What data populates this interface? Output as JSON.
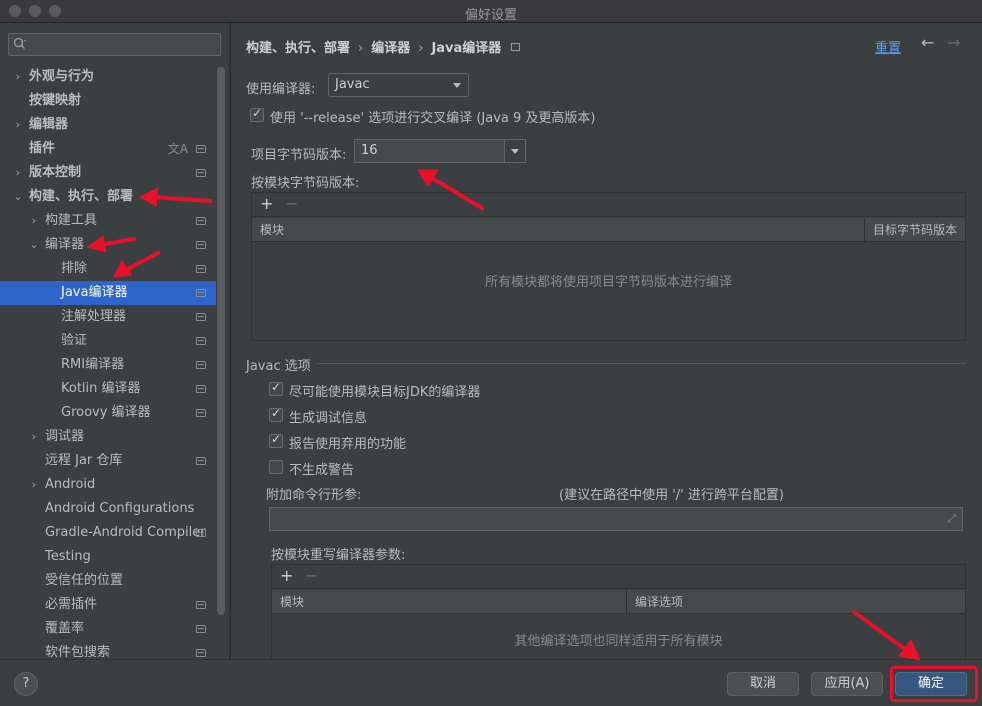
{
  "window": {
    "title": "偏好设置"
  },
  "sidebar": {
    "search_placeholder": "",
    "items": [
      {
        "label": "外观与行为",
        "level": 0,
        "arrow": "›",
        "bold": true
      },
      {
        "label": "按键映射",
        "level": 0,
        "arrow": "",
        "bold": true
      },
      {
        "label": "编辑器",
        "level": 0,
        "arrow": "›",
        "bold": true
      },
      {
        "label": "插件",
        "level": 0,
        "arrow": "",
        "bold": true,
        "lang_icon": "文A",
        "module_icon": true
      },
      {
        "label": "版本控制",
        "level": 0,
        "arrow": "›",
        "bold": true,
        "module_icon": true
      },
      {
        "label": "构建、执行、部署",
        "level": 0,
        "arrow": "⌄",
        "bold": true
      },
      {
        "label": "构建工具",
        "level": 1,
        "arrow": "›",
        "module_icon": true
      },
      {
        "label": "编译器",
        "level": 1,
        "arrow": "⌄",
        "module_icon": true
      },
      {
        "label": "排除",
        "level": 2,
        "arrow": "",
        "module_icon": true
      },
      {
        "label": "Java编译器",
        "level": 2,
        "arrow": "",
        "module_icon": true,
        "selected": true
      },
      {
        "label": "注解处理器",
        "level": 2,
        "arrow": "",
        "module_icon": true
      },
      {
        "label": "验证",
        "level": 2,
        "arrow": "",
        "module_icon": true
      },
      {
        "label": "RMI编译器",
        "level": 2,
        "arrow": "",
        "module_icon": true
      },
      {
        "label": "Kotlin 编译器",
        "level": 2,
        "arrow": "",
        "module_icon": true
      },
      {
        "label": "Groovy 编译器",
        "level": 2,
        "arrow": "",
        "module_icon": true
      },
      {
        "label": "调试器",
        "level": 1,
        "arrow": "›"
      },
      {
        "label": "远程 Jar 仓库",
        "level": 1,
        "arrow": "",
        "module_icon": true
      },
      {
        "label": "Android",
        "level": 1,
        "arrow": "›"
      },
      {
        "label": "Android Configurations",
        "level": 1,
        "arrow": ""
      },
      {
        "label": "Gradle-Android Compiler",
        "level": 1,
        "arrow": "",
        "module_icon": true
      },
      {
        "label": "Testing",
        "level": 1,
        "arrow": ""
      },
      {
        "label": "受信任的位置",
        "level": 1,
        "arrow": ""
      },
      {
        "label": "必需插件",
        "level": 1,
        "arrow": "",
        "module_icon": true
      },
      {
        "label": "覆盖率",
        "level": 1,
        "arrow": "",
        "module_icon": true
      },
      {
        "label": "软件包搜索",
        "level": 1,
        "arrow": "",
        "module_icon": true
      }
    ]
  },
  "header": {
    "crumbs": [
      "构建、执行、部署",
      "编译器",
      "Java编译器"
    ],
    "separator": "›",
    "reset_label": "重置",
    "back_glyph": "←",
    "forward_glyph": "→"
  },
  "compiler": {
    "use_compiler_label": "使用编译器:",
    "use_compiler_value": "Javac",
    "release_checkbox_label": "使用 '--release' 选项进行交叉编译 (Java 9 及更高版本)",
    "release_checked": true,
    "project_bytecode_label": "项目字节码版本:",
    "project_bytecode_value": "16",
    "per_module_bytecode_label": "按模块字节码版本:",
    "module_table": {
      "add": "+",
      "remove": "−",
      "col_module": "模块",
      "col_target": "目标字节码版本",
      "empty": "所有模块都将使用项目字节码版本进行编译"
    }
  },
  "javac": {
    "section_title": "Javac 选项",
    "options": [
      {
        "label": "尽可能使用模块目标JDK的编译器",
        "checked": true
      },
      {
        "label": "生成调试信息",
        "checked": true
      },
      {
        "label": "报告使用弃用的功能",
        "checked": true
      },
      {
        "label": "不生成警告",
        "checked": false
      }
    ],
    "extra_params_label": "附加命令行形参:",
    "extra_params_hint": "(建议在路径中使用 '/' 进行跨平台配置)",
    "extra_params_value": "",
    "expand_glyph": "⤢",
    "override_label": "按模块重写编译器参数:",
    "override_table": {
      "add": "+",
      "remove": "−",
      "col_module": "模块",
      "col_options": "编译选项",
      "empty": "其他编译选项也同样适用于所有模块"
    }
  },
  "footer": {
    "help": "?",
    "cancel": "取消",
    "apply": "应用(A)",
    "ok": "确定"
  },
  "colors": {
    "accent": "#2f65ca",
    "primary_button": "#365880",
    "link": "#589df6",
    "annotation": "#e8102b"
  }
}
